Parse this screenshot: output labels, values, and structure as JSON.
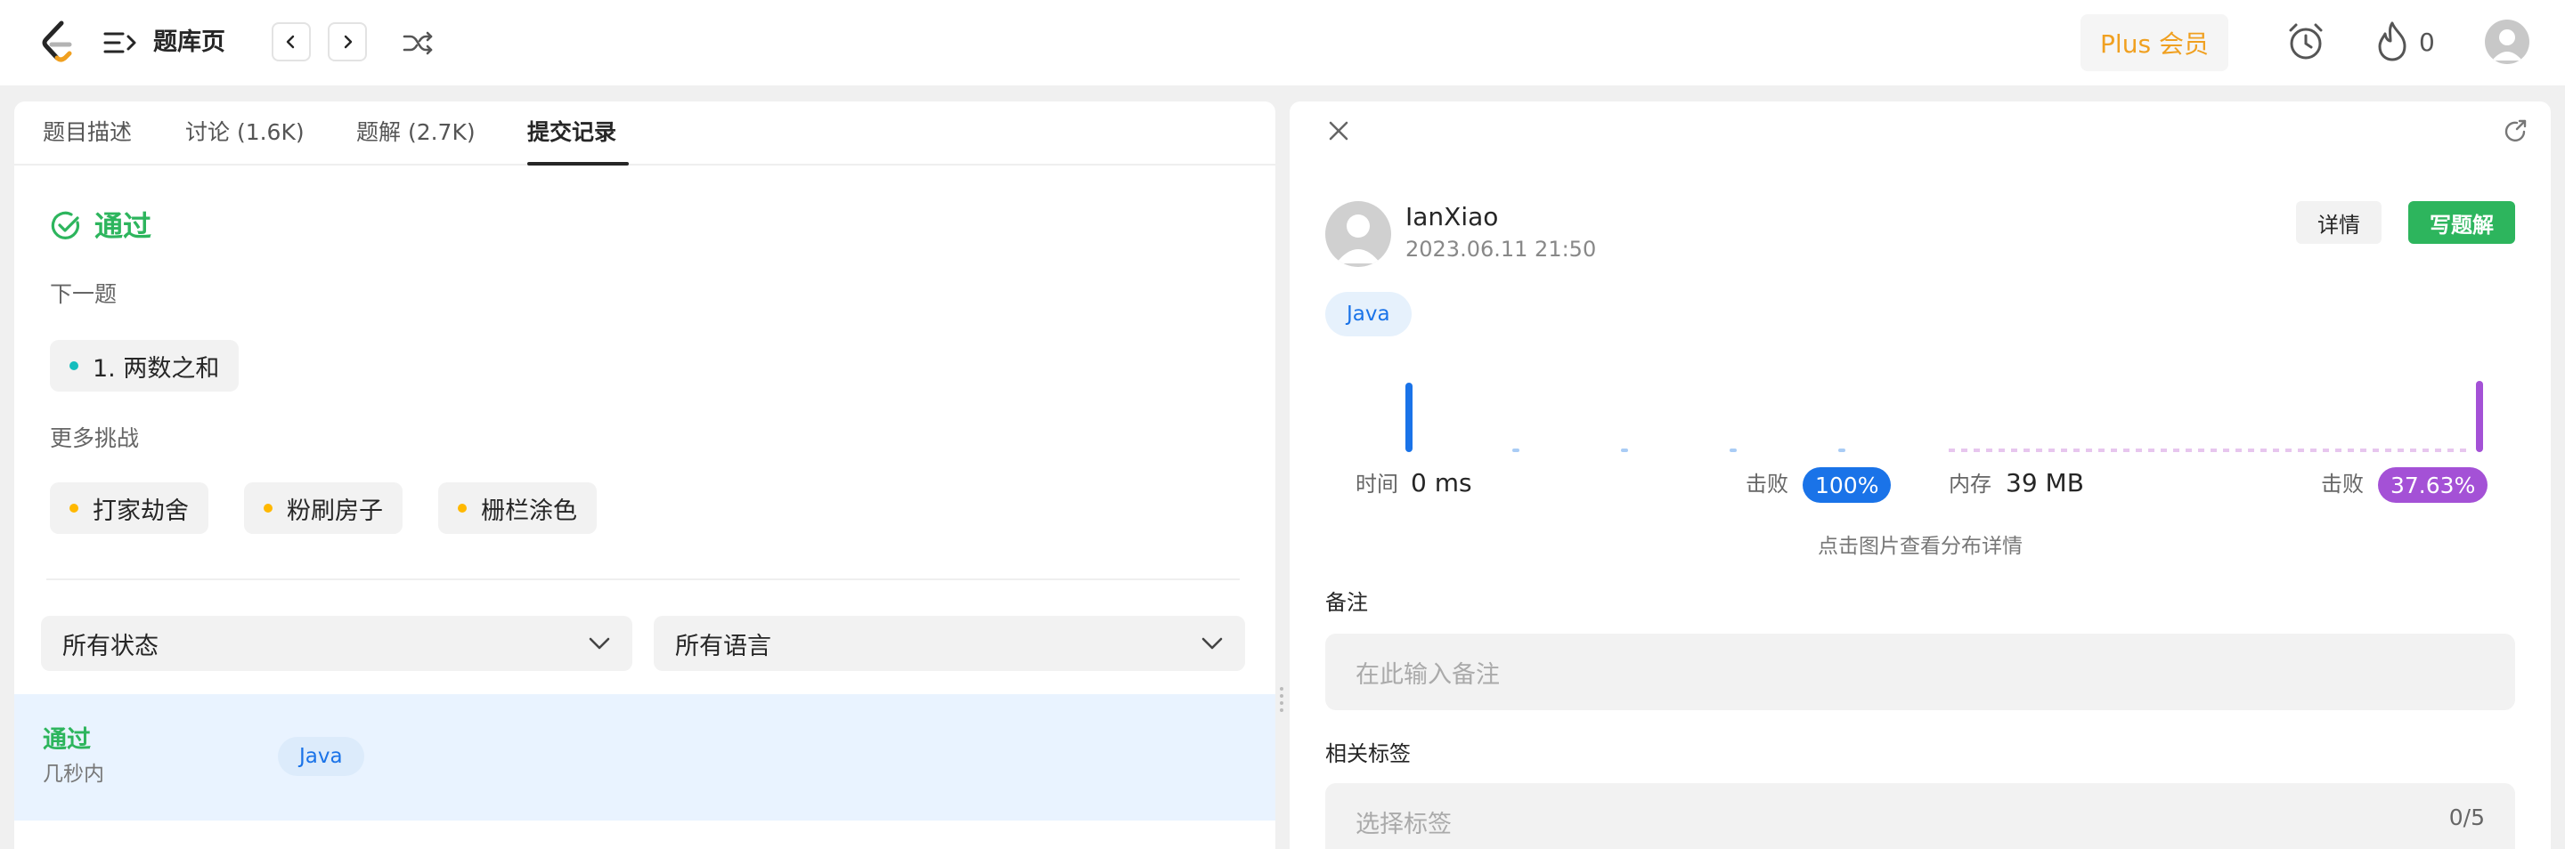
{
  "header": {
    "page_title": "题库页",
    "plus_label": "Plus 会员",
    "fire_count": "0",
    "colors": {
      "plus": "#f0a020",
      "pass": "#2db55d",
      "accent": "#1a73e8",
      "purple": "#a451d6"
    }
  },
  "left": {
    "tabs": [
      {
        "label": "题目描述"
      },
      {
        "label": "讨论 (1.6K)"
      },
      {
        "label": "题解 (2.7K)"
      },
      {
        "label": "提交记录"
      }
    ],
    "active_tab": "提交记录",
    "result_title": "通过",
    "next_label": "下一题",
    "next_problem": "1. 两数之和",
    "more_label": "更多挑战",
    "challenges": [
      {
        "label": "打家劫舍"
      },
      {
        "label": "粉刷房子"
      },
      {
        "label": "栅栏涂色"
      }
    ],
    "filter_status": "所有状态",
    "filter_language": "所有语言",
    "submission": {
      "status": "通过",
      "time": "几秒内",
      "language": "Java"
    }
  },
  "right": {
    "username": "IanXiao",
    "date": "2023.06.11 21:50",
    "detail_label": "详情",
    "write_label": "写题解",
    "language": "Java",
    "runtime_label": "时间",
    "runtime_value": "0 ms",
    "runtime_beat_label": "击败",
    "runtime_beat": "100%",
    "memory_label": "内存",
    "memory_value": "39 MB",
    "memory_beat_label": "击败",
    "memory_beat": "37.63%",
    "chart_hint": "点击图片查看分布详情",
    "note_label": "备注",
    "note_placeholder": "在此输入备注",
    "tags_label": "相关标签",
    "tags_placeholder": "选择标签",
    "tags_count": "0/5"
  }
}
